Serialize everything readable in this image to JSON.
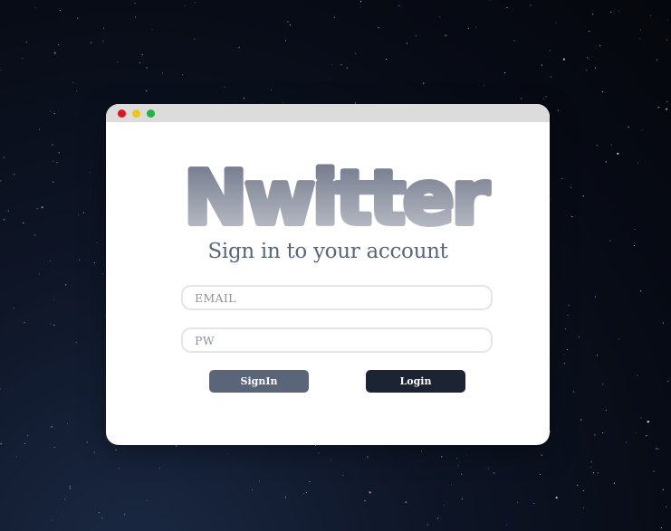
{
  "window": {
    "traffic_lights": [
      {
        "name": "close",
        "color": "#e0161b"
      },
      {
        "name": "minimize",
        "color": "#f0c419"
      },
      {
        "name": "maximize",
        "color": "#1fb545"
      }
    ]
  },
  "brand": {
    "logo_text": "Nwitter",
    "logo_gradient": [
      "#6d7487",
      "#b9bdc7"
    ]
  },
  "form": {
    "heading": "Sign in to your account",
    "email_placeholder": "EMAIL",
    "email_value": "",
    "password_placeholder": "PW",
    "password_value": ""
  },
  "actions": {
    "signin_label": "SignIn",
    "login_label": "Login"
  },
  "colors": {
    "signin_button": "#5a657a",
    "login_button": "#1c2333",
    "heading": "#5a667a"
  }
}
